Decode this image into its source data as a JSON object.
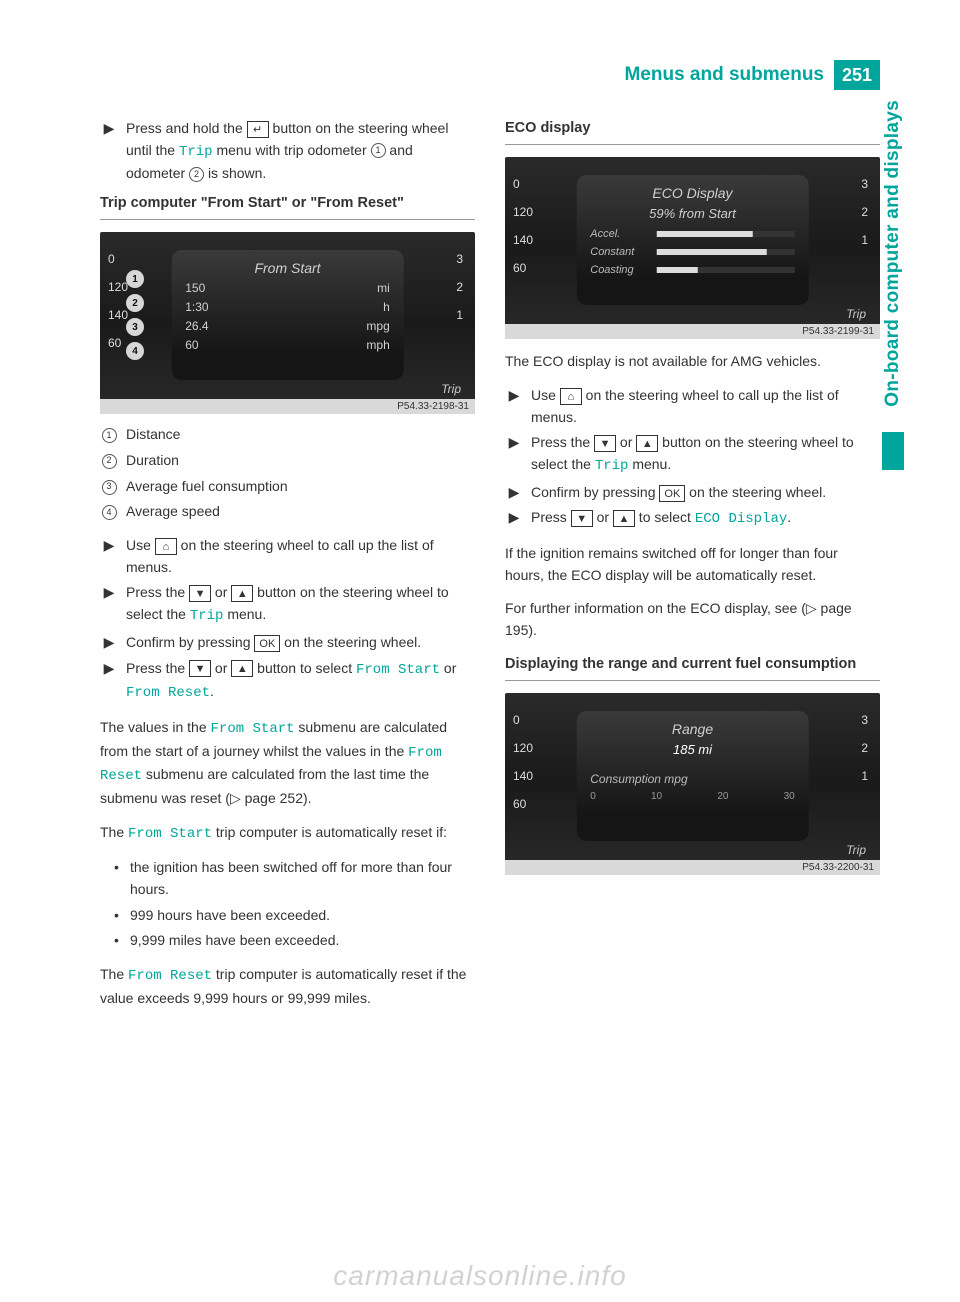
{
  "header": {
    "section": "Menus and submenus",
    "page": "251",
    "sideTab": "On-board computer and displays"
  },
  "col1": {
    "step1": {
      "pre": "Press and hold the ",
      "btn": "↵",
      "mid": " button on the steering wheel until the ",
      "teal": "Trip",
      "post": " menu with trip odometer ",
      "c1": "1",
      "and": " and odometer ",
      "c2": "2",
      "end": " is shown."
    },
    "heading1": "Trip computer \"From Start\" or \"From Reset\"",
    "fig1": {
      "title": "From Start",
      "r1a": "150",
      "r1b": "mi",
      "r2a": "1:30",
      "r2b": "h",
      "r3a": "26.4",
      "r3b": "mpg",
      "r4a": "60",
      "r4b": "mph",
      "trip": "Trip",
      "left": [
        "0",
        "120",
        "140",
        "60"
      ],
      "right": [
        "3",
        "2",
        "1"
      ],
      "callouts": [
        "1",
        "2",
        "3",
        "4"
      ],
      "code": "P54.33-2198-31"
    },
    "legend": {
      "i1": {
        "n": "1",
        "t": "Distance"
      },
      "i2": {
        "n": "2",
        "t": "Duration"
      },
      "i3": {
        "n": "3",
        "t": "Average fuel consumption"
      },
      "i4": {
        "n": "4",
        "t": "Average speed"
      }
    },
    "step2": {
      "pre": "Use ",
      "btn": "⌂",
      "post": " on the steering wheel to call up the list of menus."
    },
    "step3": {
      "pre": "Press the ",
      "b1": "▼",
      "or": " or ",
      "b2": "▲",
      "mid": " button on the steering wheel to select the ",
      "teal": "Trip",
      "post": " menu."
    },
    "step4": {
      "pre": "Confirm by pressing ",
      "b": "OK",
      "post": " on the steering wheel."
    },
    "step5": {
      "pre": "Press the ",
      "b1": "▼",
      "or": " or ",
      "b2": "▲",
      "mid": " button to select ",
      "t1": "From Start",
      "or2": " or ",
      "t2": "From Reset",
      "dot": "."
    },
    "p1": {
      "a": "The values in the ",
      "t1": "From Start",
      "b": " submenu are calculated from the start of a journey whilst the values in the ",
      "t2": "From Reset",
      "c": " submenu are calculated from the last time the submenu was reset (▷ page 252)."
    },
    "p2": {
      "a": "The ",
      "t": "From Start",
      "b": " trip computer is automatically reset if:"
    },
    "bullets": {
      "b1": "the ignition has been switched off for more than four hours.",
      "b2": "999 hours have been exceeded.",
      "b3": "9,999 miles have been exceeded."
    },
    "p3": {
      "a": "The ",
      "t": "From Reset",
      "b": " trip computer is automatically reset if the value exceeds 9,999 hours or 99,999 miles."
    }
  },
  "col2": {
    "heading1": "ECO display",
    "fig2": {
      "title": "ECO Display",
      "sub": "59% from Start",
      "rows": {
        "r1": "Accel.",
        "r2": "Constant",
        "r3": "Coasting"
      },
      "trip": "Trip",
      "left": [
        "0",
        "120",
        "140",
        "60"
      ],
      "right": [
        "3",
        "2",
        "1"
      ],
      "code": "P54.33-2199-31"
    },
    "p1": "The ECO display is not available for AMG vehicles.",
    "step1": {
      "pre": "Use ",
      "btn": "⌂",
      "post": " on the steering wheel to call up the list of menus."
    },
    "step2": {
      "pre": "Press the ",
      "b1": "▼",
      "or": " or ",
      "b2": "▲",
      "mid": " button on the steering wheel to select the ",
      "teal": "Trip",
      "post": " menu."
    },
    "step3": {
      "pre": "Confirm by pressing ",
      "b": "OK",
      "post": " on the steering wheel."
    },
    "step4": {
      "pre": "Press ",
      "b1": "▼",
      "or": " or ",
      "b2": "▲",
      "mid": " to select ",
      "t": "ECO Display",
      "dot": "."
    },
    "p2": "If the ignition remains switched off for longer than four hours, the ECO display will be automatically reset.",
    "p3": "For further information on the ECO display, see (▷ page 195).",
    "heading2": "Displaying the range and current fuel consumption",
    "fig3": {
      "title": "Range",
      "sub": "185 mi",
      "row": "Consumption mpg",
      "scale": [
        "0",
        "10",
        "20",
        "30"
      ],
      "trip": "Trip",
      "left": [
        "0",
        "120",
        "140",
        "60"
      ],
      "right": [
        "3",
        "2",
        "1"
      ],
      "code": "P54.33-2200-31"
    }
  },
  "watermark": "carmanualsonline.info"
}
